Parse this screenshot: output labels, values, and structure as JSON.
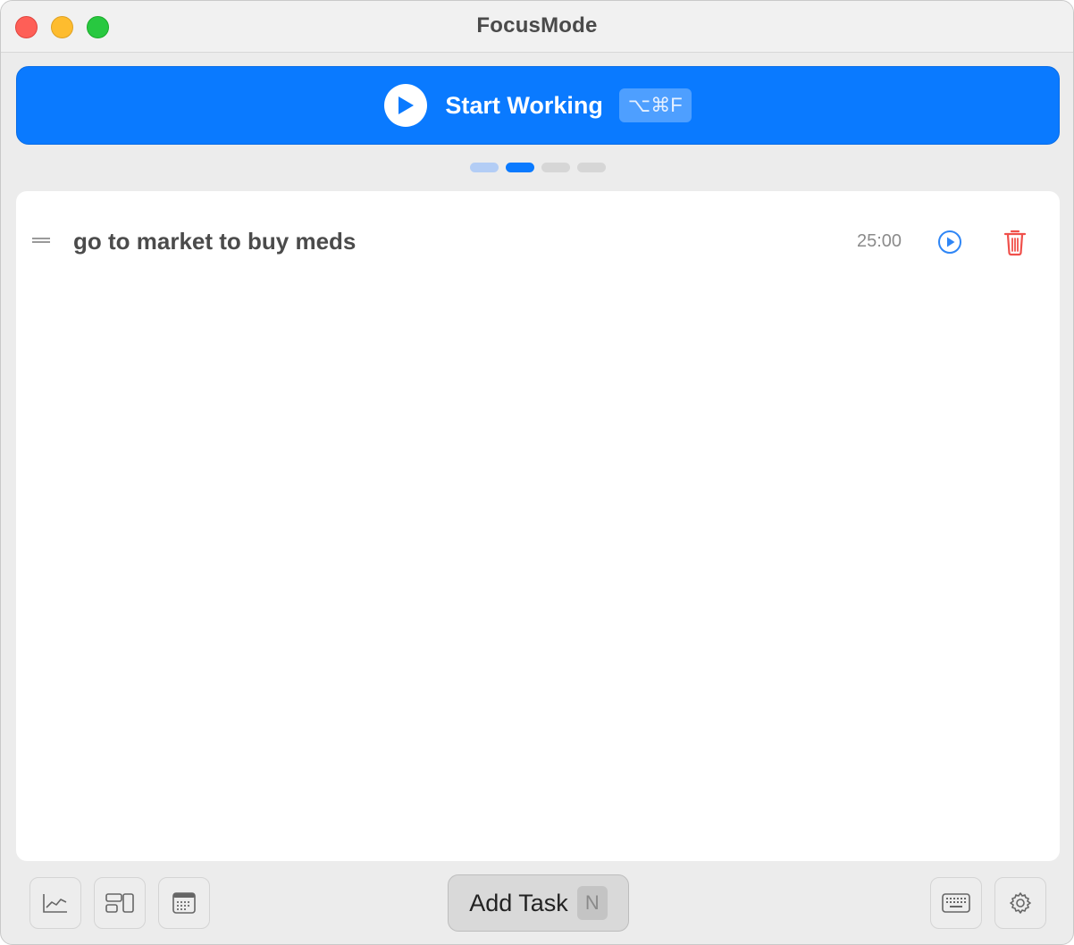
{
  "window": {
    "title": "FocusMode"
  },
  "start": {
    "label": "Start Working",
    "shortcut": "⌥⌘F"
  },
  "pager": {
    "pages": 4,
    "active_index": 1
  },
  "tasks": [
    {
      "title": "go to market to buy meds",
      "duration": "25:00"
    }
  ],
  "toolbar": {
    "left": [
      "chart-icon",
      "layout-icon",
      "calendar-icon"
    ],
    "right": [
      "keyboard-icon",
      "gear-icon"
    ],
    "add_task_label": "Add Task",
    "add_task_shortcut": "N"
  },
  "colors": {
    "accent": "#0a7aff",
    "delete": "#f0504b",
    "close": "#fe5f57",
    "minimize": "#febc2e",
    "maximize": "#28c840"
  }
}
